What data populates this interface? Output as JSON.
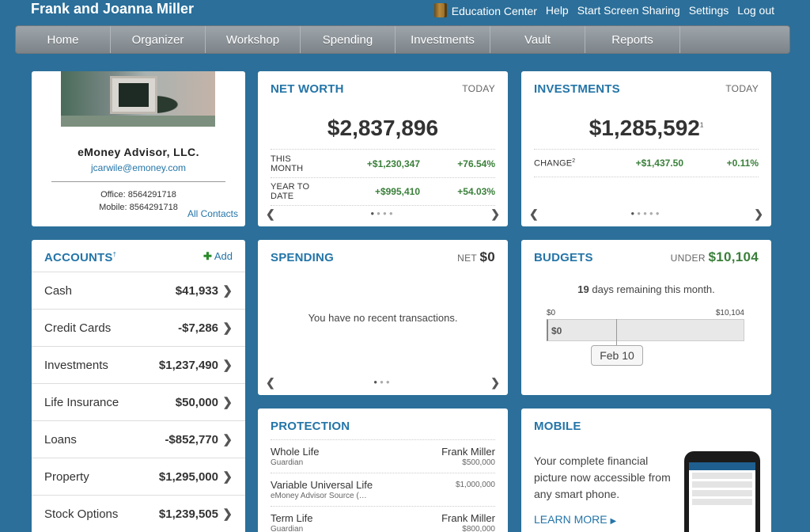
{
  "client": {
    "name": "Frank and Joanna Miller"
  },
  "top_links": {
    "education": "Education Center",
    "help": "Help",
    "screen_sharing": "Start Screen Sharing",
    "settings": "Settings",
    "logout": "Log out"
  },
  "nav": [
    "Home",
    "Organizer",
    "Workshop",
    "Spending",
    "Investments",
    "Vault",
    "Reports"
  ],
  "advisor": {
    "firm": "eMoney Advisor, LLC.",
    "email": "jcarwile@emoney.com",
    "office": "Office: 8564291718",
    "mobile": "Mobile: 8564291718",
    "all_contacts": "All Contacts"
  },
  "net_worth": {
    "title": "NET WORTH",
    "tag": "TODAY",
    "value": "$2,837,896",
    "rows": [
      {
        "label": "THIS MONTH",
        "amount": "+$1,230,347",
        "pct": "+76.54%"
      },
      {
        "label": "YEAR TO DATE",
        "amount": "+$995,410",
        "pct": "+54.03%"
      }
    ]
  },
  "investments": {
    "title": "INVESTMENTS",
    "tag": "TODAY",
    "value": "$1,285,592",
    "value_sup": "1",
    "change_label": "CHANGE",
    "change_sup": "2",
    "change_amount": "+$1,437.50",
    "change_pct": "+0.11%"
  },
  "accounts": {
    "title": "ACCOUNTS",
    "title_sup": "†",
    "add_label": "Add",
    "rows": [
      {
        "name": "Cash",
        "amount": "$41,933"
      },
      {
        "name": "Credit Cards",
        "amount": "-$7,286"
      },
      {
        "name": "Investments",
        "amount": "$1,237,490"
      },
      {
        "name": "Life Insurance",
        "amount": "$50,000"
      },
      {
        "name": "Loans",
        "amount": "-$852,770"
      },
      {
        "name": "Property",
        "amount": "$1,295,000"
      },
      {
        "name": "Stock Options",
        "amount": "$1,239,505"
      }
    ]
  },
  "spending": {
    "title": "SPENDING",
    "net_label": "NET",
    "net_value": "$0",
    "empty_message": "You have no recent transactions."
  },
  "budgets": {
    "title": "BUDGETS",
    "under_label": "UNDER",
    "under_value": "$10,104",
    "days_remaining": "19",
    "days_text": "days remaining this month.",
    "scale_min": "$0",
    "scale_max": "$10,104",
    "spent": "$0",
    "spent_fraction": 0,
    "today_label": "Feb 10"
  },
  "protection": {
    "title": "PROTECTION",
    "rows": [
      {
        "name": "Whole Life",
        "sub": "Guardian",
        "owner": "Frank Miller",
        "amount": "$500,000"
      },
      {
        "name": "Variable Universal Life",
        "sub": "eMoney Advisor Source (…",
        "owner": "",
        "amount": "$1,000,000"
      },
      {
        "name": "Term Life",
        "sub": "Guardian",
        "owner": "Frank Miller",
        "amount": "$800,000"
      }
    ]
  },
  "mobile": {
    "title": "MOBILE",
    "text": "Your complete financial picture now accessible from any smart phone.",
    "learn_more": "LEARN MORE"
  },
  "colors": {
    "background": "#2b6f9a",
    "accent_blue": "#2475a8",
    "positive_green": "#3a7f3a"
  }
}
